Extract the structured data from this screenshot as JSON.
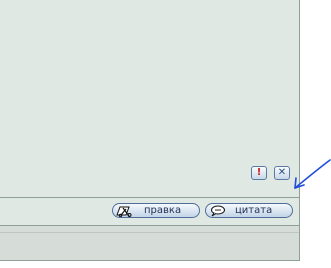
{
  "post": {
    "report_glyph": "!",
    "delete_glyph": "✕",
    "edit_label": "правка",
    "quote_label": "цитата"
  },
  "icons": {
    "report": "exclamation-icon",
    "delete": "close-icon",
    "edit": "edit-icon",
    "quote": "quote-icon",
    "annotation": "arrow-annotation-icon"
  },
  "colors": {
    "panel": "#dfe8e2",
    "button_border": "#4f6d98",
    "button_text": "#1f2f57",
    "report_icon": "#c81e1e",
    "annotation": "#1f4fd9"
  }
}
